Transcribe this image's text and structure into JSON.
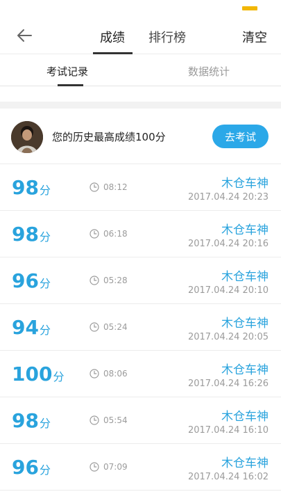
{
  "status_bar": {
    "accent_color": "#f2b705"
  },
  "header": {
    "tabs": [
      {
        "label": "成绩"
      },
      {
        "label": "排行榜"
      }
    ],
    "clear_label": "清空"
  },
  "subtabs": [
    {
      "label": "考试记录"
    },
    {
      "label": "数据统计"
    }
  ],
  "summary": {
    "text": "您的历史最高成绩100分",
    "button_label": "去考试"
  },
  "records": [
    {
      "score": "98",
      "unit": "分",
      "duration": "08:12",
      "name": "木仓车神",
      "datetime": "2017.04.24  20:23"
    },
    {
      "score": "98",
      "unit": "分",
      "duration": "06:18",
      "name": "木仓车神",
      "datetime": "2017.04.24  20:16"
    },
    {
      "score": "96",
      "unit": "分",
      "duration": "05:28",
      "name": "木仓车神",
      "datetime": "2017.04.24  20:10"
    },
    {
      "score": "94",
      "unit": "分",
      "duration": "05:24",
      "name": "木仓车神",
      "datetime": "2017.04.24  20:05"
    },
    {
      "score": "100",
      "unit": "分",
      "duration": "08:06",
      "name": "木仓车神",
      "datetime": "2017.04.24  16:26"
    },
    {
      "score": "98",
      "unit": "分",
      "duration": "05:54",
      "name": "木仓车神",
      "datetime": "2017.04.24  16:10"
    },
    {
      "score": "96",
      "unit": "分",
      "duration": "07:09",
      "name": "木仓车神",
      "datetime": "2017.04.24  16:02"
    }
  ],
  "colors": {
    "accent": "#29a3dd",
    "button": "#2ba8e8"
  },
  "icons": {
    "back": "back-arrow-icon",
    "clock": "clock-icon"
  }
}
